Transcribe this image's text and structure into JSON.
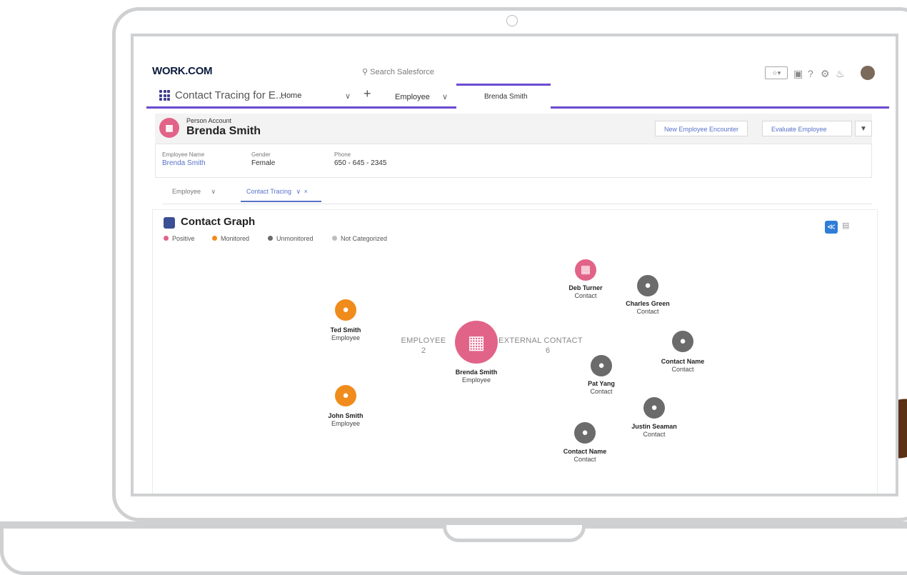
{
  "app": {
    "logo": "WORK.COM",
    "search_placeholder": "Search Salesforce",
    "app_name": "Contact Tracing for E...",
    "nav_home": "Home",
    "nav_plus": "+",
    "nav_employee": "Employee",
    "active_tab": "Brenda Smith",
    "util_icons": [
      "favorites-icon",
      "add-icon",
      "help-icon",
      "setup-gear-icon",
      "notification-bell-icon",
      "user-avatar"
    ]
  },
  "record": {
    "type_label": "Person Account",
    "name": "Brenda Smith",
    "buttons": {
      "new_encounter": "New Employee Encounter",
      "evaluate": "Evaluate Employee"
    },
    "fields": [
      {
        "label": "Employee Name",
        "value": "Brenda Smith"
      },
      {
        "label": "Gender",
        "value": "Female"
      },
      {
        "label": "Phone",
        "value": "650 - 645 - 2345"
      }
    ]
  },
  "subtabs": {
    "employee": "Employee",
    "contact_tracing": "Contact Tracing"
  },
  "graph": {
    "title": "Contact Graph",
    "legend": [
      {
        "label": "Positive",
        "color": "#e26388"
      },
      {
        "label": "Monitored",
        "color": "#f08c1c"
      },
      {
        "label": "Unmonitored",
        "color": "#6b6b6b"
      },
      {
        "label": "Not Categorized",
        "color": "#bdbdbd"
      }
    ],
    "center": {
      "name": "Brenda Smith",
      "type": "Employee"
    },
    "groups": {
      "employee": {
        "label": "EMPLOYEE",
        "count": "2"
      },
      "external": {
        "label": "EXTERNAL CONTACT",
        "count": "6"
      }
    },
    "employees": [
      {
        "name": "Ted Smith",
        "type": "Employee"
      },
      {
        "name": "John Smith",
        "type": "Employee"
      }
    ],
    "contacts": [
      {
        "name": "Deb Turner",
        "type": "Contact"
      },
      {
        "name": "Charles Green",
        "type": "Contact"
      },
      {
        "name": "Contact Name",
        "type": "Contact"
      },
      {
        "name": "Pat Yang",
        "type": "Contact"
      },
      {
        "name": "Justin Seaman",
        "type": "Contact"
      },
      {
        "name": "Contact Name",
        "type": "Contact"
      }
    ]
  }
}
